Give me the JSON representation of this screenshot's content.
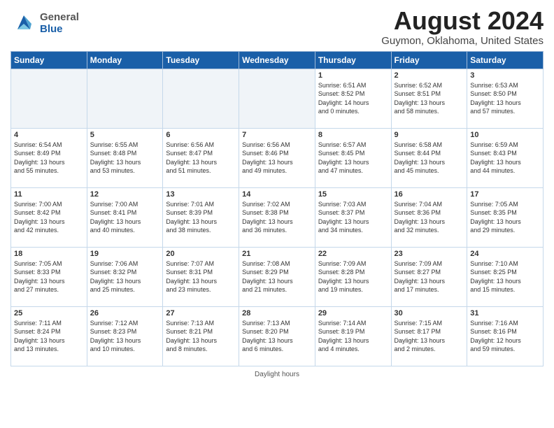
{
  "header": {
    "logo_general": "General",
    "logo_blue": "Blue",
    "month_year": "August 2024",
    "location": "Guymon, Oklahoma, United States"
  },
  "days_of_week": [
    "Sunday",
    "Monday",
    "Tuesday",
    "Wednesday",
    "Thursday",
    "Friday",
    "Saturday"
  ],
  "weeks": [
    [
      {
        "day": "",
        "empty": true
      },
      {
        "day": "",
        "empty": true
      },
      {
        "day": "",
        "empty": true
      },
      {
        "day": "",
        "empty": true
      },
      {
        "day": "1",
        "text": "Sunrise: 6:51 AM\nSunset: 8:52 PM\nDaylight: 14 hours\nand 0 minutes."
      },
      {
        "day": "2",
        "text": "Sunrise: 6:52 AM\nSunset: 8:51 PM\nDaylight: 13 hours\nand 58 minutes."
      },
      {
        "day": "3",
        "text": "Sunrise: 6:53 AM\nSunset: 8:50 PM\nDaylight: 13 hours\nand 57 minutes."
      }
    ],
    [
      {
        "day": "4",
        "text": "Sunrise: 6:54 AM\nSunset: 8:49 PM\nDaylight: 13 hours\nand 55 minutes."
      },
      {
        "day": "5",
        "text": "Sunrise: 6:55 AM\nSunset: 8:48 PM\nDaylight: 13 hours\nand 53 minutes."
      },
      {
        "day": "6",
        "text": "Sunrise: 6:56 AM\nSunset: 8:47 PM\nDaylight: 13 hours\nand 51 minutes."
      },
      {
        "day": "7",
        "text": "Sunrise: 6:56 AM\nSunset: 8:46 PM\nDaylight: 13 hours\nand 49 minutes."
      },
      {
        "day": "8",
        "text": "Sunrise: 6:57 AM\nSunset: 8:45 PM\nDaylight: 13 hours\nand 47 minutes."
      },
      {
        "day": "9",
        "text": "Sunrise: 6:58 AM\nSunset: 8:44 PM\nDaylight: 13 hours\nand 45 minutes."
      },
      {
        "day": "10",
        "text": "Sunrise: 6:59 AM\nSunset: 8:43 PM\nDaylight: 13 hours\nand 44 minutes."
      }
    ],
    [
      {
        "day": "11",
        "text": "Sunrise: 7:00 AM\nSunset: 8:42 PM\nDaylight: 13 hours\nand 42 minutes."
      },
      {
        "day": "12",
        "text": "Sunrise: 7:00 AM\nSunset: 8:41 PM\nDaylight: 13 hours\nand 40 minutes."
      },
      {
        "day": "13",
        "text": "Sunrise: 7:01 AM\nSunset: 8:39 PM\nDaylight: 13 hours\nand 38 minutes."
      },
      {
        "day": "14",
        "text": "Sunrise: 7:02 AM\nSunset: 8:38 PM\nDaylight: 13 hours\nand 36 minutes."
      },
      {
        "day": "15",
        "text": "Sunrise: 7:03 AM\nSunset: 8:37 PM\nDaylight: 13 hours\nand 34 minutes."
      },
      {
        "day": "16",
        "text": "Sunrise: 7:04 AM\nSunset: 8:36 PM\nDaylight: 13 hours\nand 32 minutes."
      },
      {
        "day": "17",
        "text": "Sunrise: 7:05 AM\nSunset: 8:35 PM\nDaylight: 13 hours\nand 29 minutes."
      }
    ],
    [
      {
        "day": "18",
        "text": "Sunrise: 7:05 AM\nSunset: 8:33 PM\nDaylight: 13 hours\nand 27 minutes."
      },
      {
        "day": "19",
        "text": "Sunrise: 7:06 AM\nSunset: 8:32 PM\nDaylight: 13 hours\nand 25 minutes."
      },
      {
        "day": "20",
        "text": "Sunrise: 7:07 AM\nSunset: 8:31 PM\nDaylight: 13 hours\nand 23 minutes."
      },
      {
        "day": "21",
        "text": "Sunrise: 7:08 AM\nSunset: 8:29 PM\nDaylight: 13 hours\nand 21 minutes."
      },
      {
        "day": "22",
        "text": "Sunrise: 7:09 AM\nSunset: 8:28 PM\nDaylight: 13 hours\nand 19 minutes."
      },
      {
        "day": "23",
        "text": "Sunrise: 7:09 AM\nSunset: 8:27 PM\nDaylight: 13 hours\nand 17 minutes."
      },
      {
        "day": "24",
        "text": "Sunrise: 7:10 AM\nSunset: 8:25 PM\nDaylight: 13 hours\nand 15 minutes."
      }
    ],
    [
      {
        "day": "25",
        "text": "Sunrise: 7:11 AM\nSunset: 8:24 PM\nDaylight: 13 hours\nand 13 minutes."
      },
      {
        "day": "26",
        "text": "Sunrise: 7:12 AM\nSunset: 8:23 PM\nDaylight: 13 hours\nand 10 minutes."
      },
      {
        "day": "27",
        "text": "Sunrise: 7:13 AM\nSunset: 8:21 PM\nDaylight: 13 hours\nand 8 minutes."
      },
      {
        "day": "28",
        "text": "Sunrise: 7:13 AM\nSunset: 8:20 PM\nDaylight: 13 hours\nand 6 minutes."
      },
      {
        "day": "29",
        "text": "Sunrise: 7:14 AM\nSunset: 8:19 PM\nDaylight: 13 hours\nand 4 minutes."
      },
      {
        "day": "30",
        "text": "Sunrise: 7:15 AM\nSunset: 8:17 PM\nDaylight: 13 hours\nand 2 minutes."
      },
      {
        "day": "31",
        "text": "Sunrise: 7:16 AM\nSunset: 8:16 PM\nDaylight: 12 hours\nand 59 minutes."
      }
    ]
  ],
  "footer": {
    "daylight_label": "Daylight hours"
  }
}
